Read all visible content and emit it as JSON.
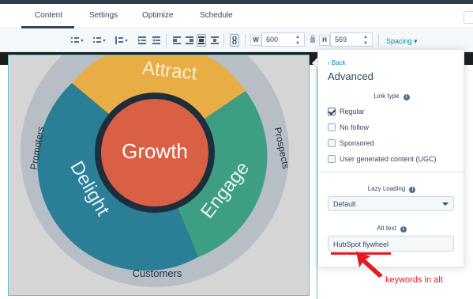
{
  "tabs": {
    "items": [
      {
        "label": "Content",
        "active": true
      },
      {
        "label": "Settings",
        "active": false
      },
      {
        "label": "Optimize",
        "active": false
      },
      {
        "label": "Schedule",
        "active": false
      }
    ]
  },
  "toolbar": {
    "width_label": "W",
    "width_value": "600",
    "height_label": "H",
    "height_value": "569",
    "spacing_label": "Spacing"
  },
  "image": {
    "segments": {
      "attract": "Attract",
      "engage": "Engage",
      "delight": "Delight",
      "growth": "Growth"
    },
    "ring_labels": {
      "promoters": "Promoters",
      "prospects": "Prospects",
      "customers": "Customers"
    },
    "colors": {
      "attract": "#e8ad45",
      "engage": "#3e9e83",
      "delight": "#2a7f96",
      "growth": "#d95f45",
      "ring": "#1e2d3b",
      "outer": "#b4bcc4"
    }
  },
  "panel": {
    "back_label": "Back",
    "title": "Advanced",
    "link_type_label": "Link type",
    "link_options": [
      {
        "label": "Regular",
        "checked": true
      },
      {
        "label": "No follow",
        "checked": false
      },
      {
        "label": "Sponsored",
        "checked": false
      },
      {
        "label": "User generated content (UGC)",
        "checked": false
      }
    ],
    "lazy_loading_label": "Lazy Loading",
    "lazy_loading_value": "Default",
    "alt_text_label": "Alt text",
    "alt_text_value": "HubSpot flywheel"
  },
  "annotation": {
    "text": "keywords in alt",
    "color": "#e11b22"
  }
}
